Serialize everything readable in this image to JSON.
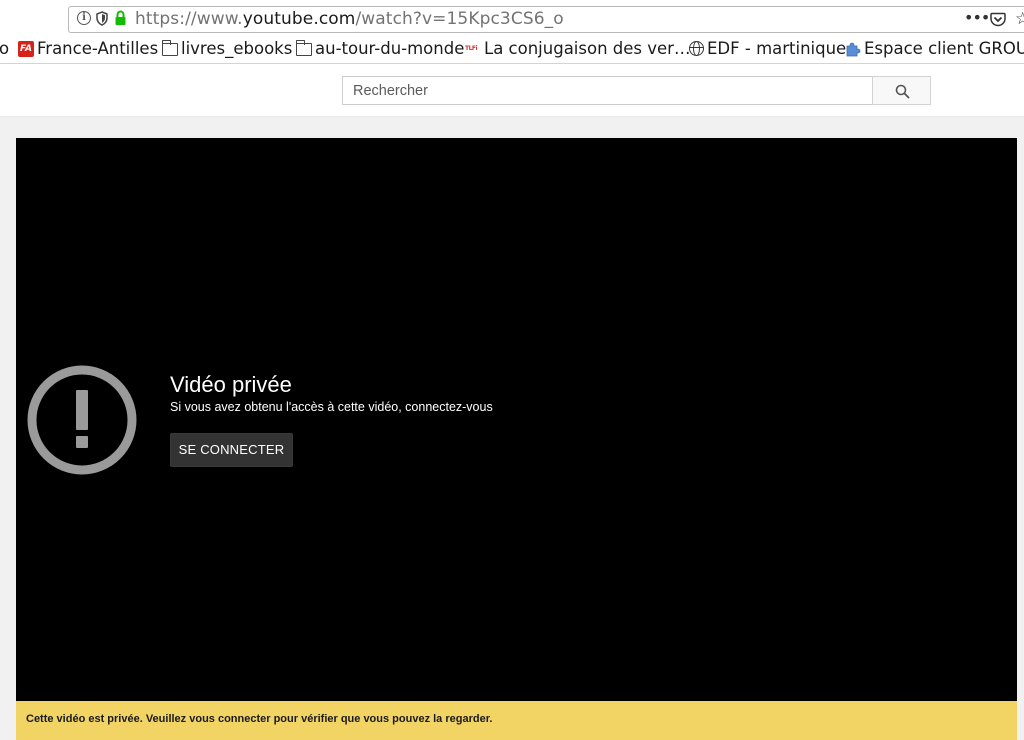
{
  "browser": {
    "url_prefix": "https://www.",
    "url_domain": "youtube.com",
    "url_path": "/watch?v=15Kpc3CS6_o",
    "more_icon": "more-dots-icon",
    "bookmarks": [
      {
        "label": "o",
        "icon": "none"
      },
      {
        "label": "France-Antilles",
        "icon": "france-antilles-icon",
        "icon_text": "FA"
      },
      {
        "label": "livres_ebooks",
        "icon": "folder-icon"
      },
      {
        "label": "au-tour-du-monde",
        "icon": "folder-icon"
      },
      {
        "label": "La conjugaison des ver…",
        "icon": "tlfi-icon",
        "icon_text": "TLFi"
      },
      {
        "label": "EDF - martinique",
        "icon": "globe-icon"
      },
      {
        "label": "Espace client GROUPE",
        "icon": "puzzle-icon"
      }
    ]
  },
  "youtube": {
    "search_placeholder": "Rechercher",
    "player": {
      "title": "Vidéo privée",
      "subtitle": "Si vous avez obtenu l'accès à cette vidéo, connectez-vous",
      "signin_label": "SE CONNECTER"
    },
    "banner": "Cette vidéo est privée. Veuillez vous connecter pour vérifier que vous pouvez la regarder."
  },
  "colors": {
    "banner_bg": "#f2d464",
    "player_bg": "#000000",
    "lock_green": "#12bc00"
  }
}
